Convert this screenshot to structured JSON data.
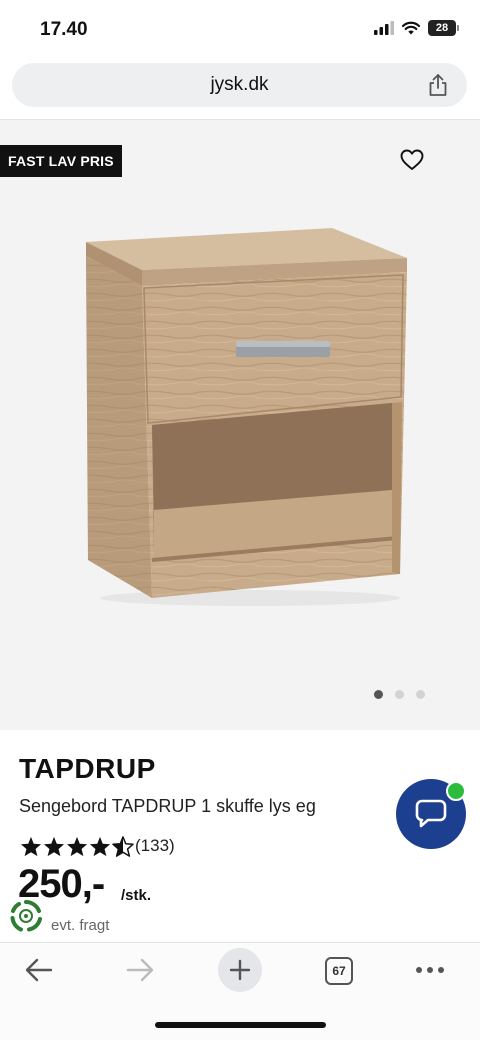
{
  "status_bar": {
    "time": "17.40",
    "battery": "28"
  },
  "browser": {
    "url": "jysk.dk",
    "tab_count": "67"
  },
  "product": {
    "badge": "FAST LAV PRIS",
    "brand": "TAPDRUP",
    "subtitle": "Sengebord TAPDRUP 1 skuffe lys eg",
    "rating": 4.5,
    "review_count": "(133)",
    "price": "250,-",
    "unit": "/stk.",
    "freight_note": "evt. fragt",
    "gallery": {
      "image_count": 3,
      "active_index": 0
    }
  },
  "colors": {
    "chat_button": "#1d3f8f",
    "online_dot": "#2dbb3c",
    "badge_bg": "#111111",
    "eco_green": "#2e7d32"
  },
  "icons": [
    "share-icon",
    "heart-icon",
    "chat-icon",
    "star-icon",
    "eco-icon",
    "back-arrow-icon",
    "forward-arrow-icon",
    "plus-icon",
    "tabs-icon",
    "more-icon"
  ]
}
